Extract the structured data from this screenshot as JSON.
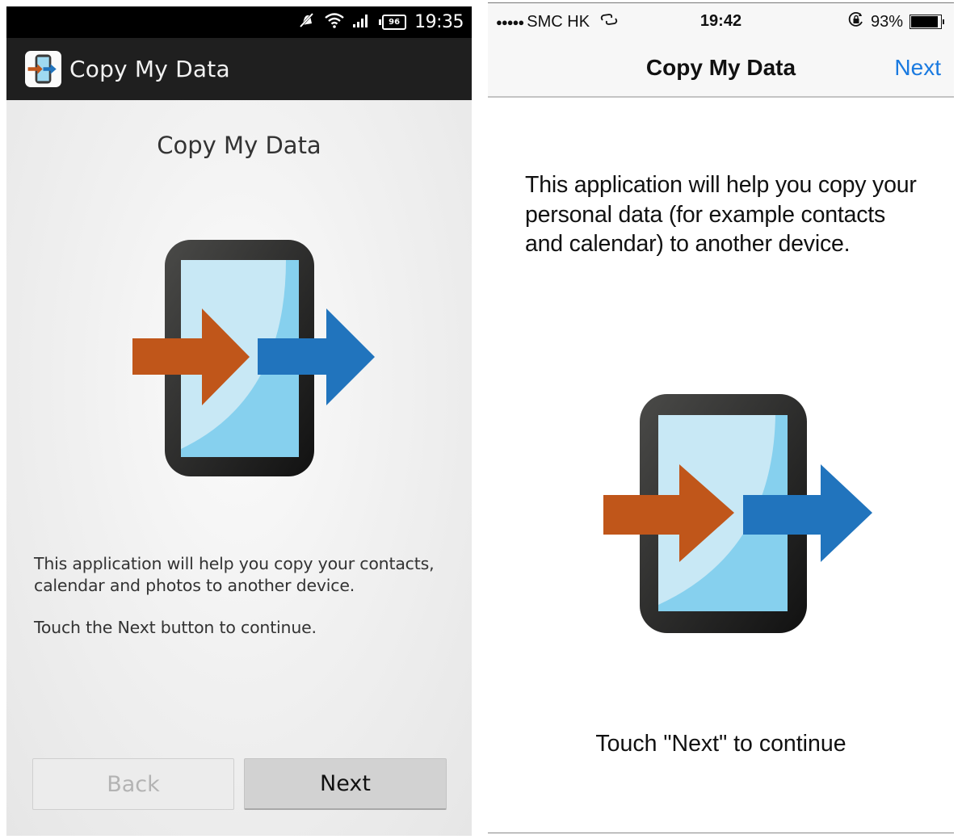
{
  "android": {
    "status_bar": {
      "icons": [
        "notifications-muted-icon",
        "wifi-icon",
        "signal-icon",
        "battery-icon"
      ],
      "battery_level": "96",
      "time": "19:35"
    },
    "action_bar": {
      "app_icon": "copy-my-data-app-icon",
      "title": "Copy My Data"
    },
    "heading": "Copy My Data",
    "illustration": "phone-transfer-arrows",
    "description": "This application will help you copy your contacts, calendar and photos to another device.",
    "hint": "Touch the Next button to continue.",
    "buttons": {
      "back": {
        "label": "Back",
        "enabled": false
      },
      "next": {
        "label": "Next",
        "enabled": true
      }
    }
  },
  "ios": {
    "status_bar": {
      "signal_dots": "●●●●●",
      "carrier": "SMC HK",
      "activity_icon": "link-icon",
      "time": "19:42",
      "rotation_lock_icon": "rotation-lock-icon",
      "battery_percent": "93%",
      "battery_fraction": 0.93
    },
    "nav_bar": {
      "title": "Copy My Data",
      "next_label": "Next"
    },
    "description": "This application will help you copy your personal data (for example contacts and calendar) to another device.",
    "illustration": "phone-transfer-arrows",
    "hint": "Touch \"Next\" to continue"
  },
  "colors": {
    "orange_arrow": "#c0561a",
    "blue_arrow": "#2174bd",
    "screen_light": "#c8e8f5",
    "screen_dark": "#86d0ee",
    "phone_frame": "#3a3a3a",
    "ios_link": "#1a7ae0"
  }
}
